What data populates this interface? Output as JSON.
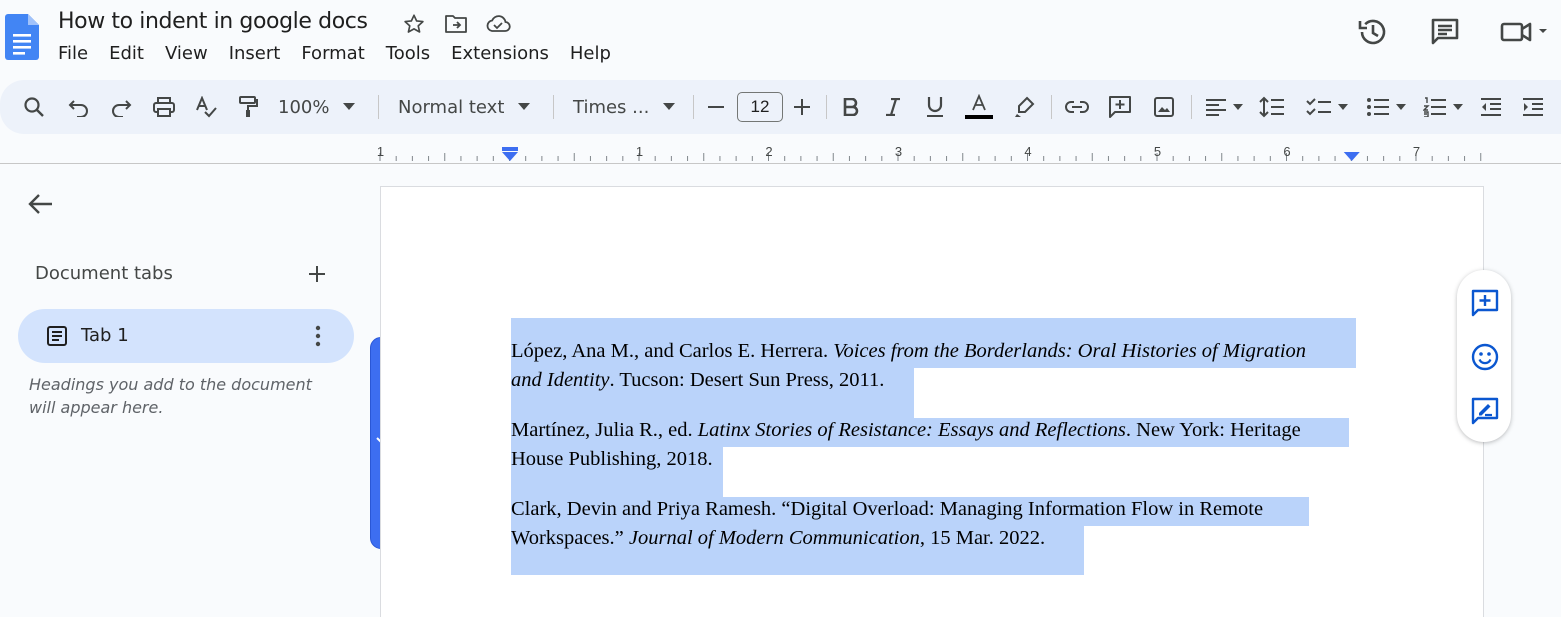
{
  "document": {
    "title": "How to indent in google docs"
  },
  "menu": [
    "File",
    "Edit",
    "View",
    "Insert",
    "Format",
    "Tools",
    "Extensions",
    "Help"
  ],
  "toolbar": {
    "zoom": "100%",
    "style": "Normal text",
    "font": "Times ...",
    "font_size": "12",
    "text_color_accent": "#000000"
  },
  "ruler": {
    "labels": [
      "1",
      "1",
      "2",
      "3",
      "4",
      "5",
      "6",
      "7"
    ]
  },
  "sidebar": {
    "title": "Document tabs",
    "tabs": [
      {
        "label": "Tab 1"
      }
    ],
    "hint": "Headings you add to the document will appear here."
  },
  "page": {
    "entries": [
      {
        "line1_a": "López, Ana M., and Carlos E. Herrera. ",
        "line1_i": "Voices from the Borderlands: Oral Histories of Migration",
        "line2_i": "and Identity",
        "line2_b": ". Tucson: Desert Sun Press, 2011."
      },
      {
        "line1_a": "Martínez, Julia R., ed. ",
        "line1_i": "Latinx Stories of Resistance: Essays and Reflections",
        "line1_b": ". New York: Heritage",
        "line2_a": "House Publishing, 2018."
      },
      {
        "line1_a": "Clark, Devin and Priya Ramesh. “Digital Overload: Managing Information Flow in Remote",
        "line2_a": "Workspaces.” ",
        "line2_i": "Journal of Modern Communication",
        "line2_b": ", 15 Mar. 2022."
      }
    ]
  },
  "colors": {
    "selection": "#bad3fa",
    "accent": "#3d6ef1",
    "tab_active_bg": "#d3e3fd",
    "doc_icon": "#4285f4"
  },
  "icons": {
    "title": [
      "star-icon",
      "move-to-folder-icon",
      "cloud-saved-icon"
    ],
    "right": [
      "version-history-icon",
      "comments-icon",
      "meet-icon"
    ],
    "float": [
      "add-comment-icon",
      "emoji-reaction-icon",
      "suggest-edits-icon"
    ]
  }
}
